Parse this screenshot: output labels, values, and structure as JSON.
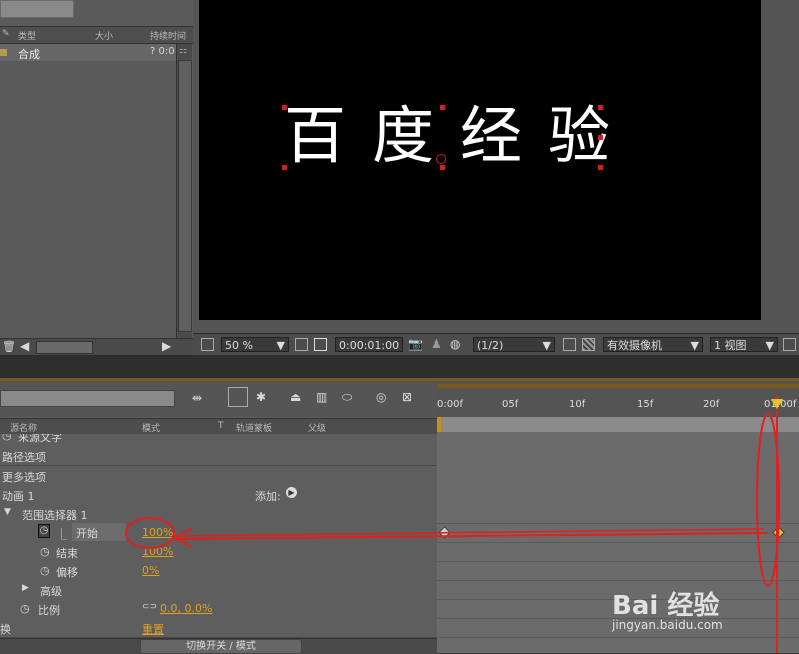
{
  "project": {
    "columns": [
      "类型",
      "大小",
      "持续时间"
    ],
    "row_name": "合成",
    "row_duration": "? 0:0"
  },
  "viewer": {
    "comp_text": "百度经验",
    "zoom": "50 %",
    "timecode": "0:00:01:00",
    "resolution": "(1/2)",
    "camera": "有效摄像机",
    "views": "1 视图"
  },
  "timeline": {
    "columns": {
      "source": "源名称",
      "mode": "模式",
      "t": "T",
      "trackmatte": "轨道蒙板",
      "parent": "父级"
    },
    "ruler": [
      "0:00f",
      "05f",
      "10f",
      "15f",
      "20f",
      "01:00f"
    ],
    "rows": {
      "source_text": "来源文字",
      "path_options": "路径选项",
      "more_options": "更多选项",
      "animator": "动画 1",
      "add_label": "添加:",
      "range_selector": "范围选择器 1",
      "start": "开始",
      "start_value": "100%",
      "end": "结束",
      "end_value": "100%",
      "offset": "偏移",
      "offset_value": "0%",
      "advanced": "高级",
      "scale": "比例",
      "scale_value": "0.0, 0.0%",
      "transform": "换",
      "reset": "重置"
    },
    "toggle_label": "切换开关 / 模式"
  },
  "watermark": {
    "logo": "Bai 经验",
    "url": "jingyan.baidu.com"
  },
  "colors": {
    "accent": "#e2a020",
    "playhead": "#dd2222",
    "annotation": "#e02020"
  }
}
